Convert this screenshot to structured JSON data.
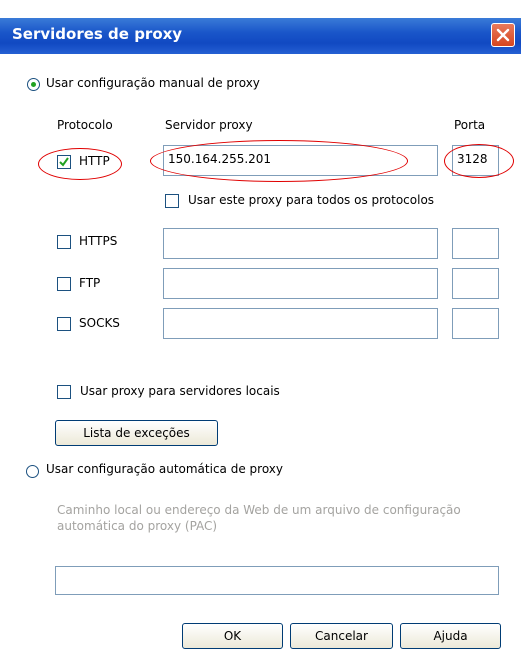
{
  "window": {
    "title": "Servidores de proxy"
  },
  "manual": {
    "radio_label": "Usar configuração manual de proxy",
    "selected": true,
    "headers": {
      "protocol": "Protocolo",
      "server": "Servidor proxy",
      "port": "Porta"
    },
    "rows": [
      {
        "label": "HTTP",
        "checked": true,
        "server": "150.164.255.201",
        "port": "3128"
      },
      {
        "label": "HTTPS",
        "checked": false,
        "server": "",
        "port": ""
      },
      {
        "label": "FTP",
        "checked": false,
        "server": "",
        "port": ""
      },
      {
        "label": "SOCKS",
        "checked": false,
        "server": "",
        "port": ""
      }
    ],
    "use_for_all_label": "Usar este proxy para todos os protocolos",
    "local_servers_label": "Usar proxy para servidores locais",
    "exceptions_button": "Lista de exceções"
  },
  "automatic": {
    "radio_label": "Usar configuração automática de proxy",
    "selected": false,
    "description": "Caminho local ou endereço da Web de um arquivo de configuração automática do proxy (PAC)",
    "pac_value": ""
  },
  "buttons": {
    "ok": "OK",
    "cancel": "Cancelar",
    "help": "Ajuda"
  },
  "colors": {
    "title_bar": "#1a56c9",
    "annotation": "#e00000",
    "check": "#21a121"
  },
  "icons": {
    "close": "close-icon",
    "check": "check-icon"
  }
}
